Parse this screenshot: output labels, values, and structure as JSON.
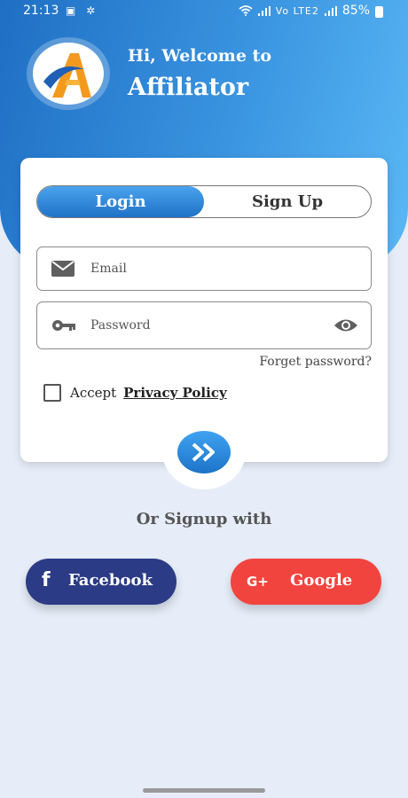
{
  "status_bar": {
    "time": "21:13",
    "left_icons": "▣ ✲",
    "signal_text": "Vo LTE2",
    "battery": "85%"
  },
  "header": {
    "welcome": "Hi, Welcome to",
    "app_name": "Affiliator"
  },
  "auth_tabs": {
    "login": "Login",
    "signup": "Sign Up",
    "active": "login"
  },
  "form": {
    "email_placeholder": "Email",
    "email_value": "",
    "password_placeholder": "Password",
    "password_value": "",
    "forget_password": "Forget password?",
    "accept_label": "Accept",
    "privacy_policy": "Privacy Policy",
    "accept_checked": false
  },
  "divider": {
    "or_signup": "Or Signup with"
  },
  "social": {
    "facebook_label": "Facebook",
    "facebook_icon": "f",
    "google_label": "Google",
    "google_icon": "G+"
  },
  "colors": {
    "primary": "#1f72c6",
    "facebook": "#2b3b86",
    "google": "#f2443e",
    "background": "#e6edf8"
  }
}
